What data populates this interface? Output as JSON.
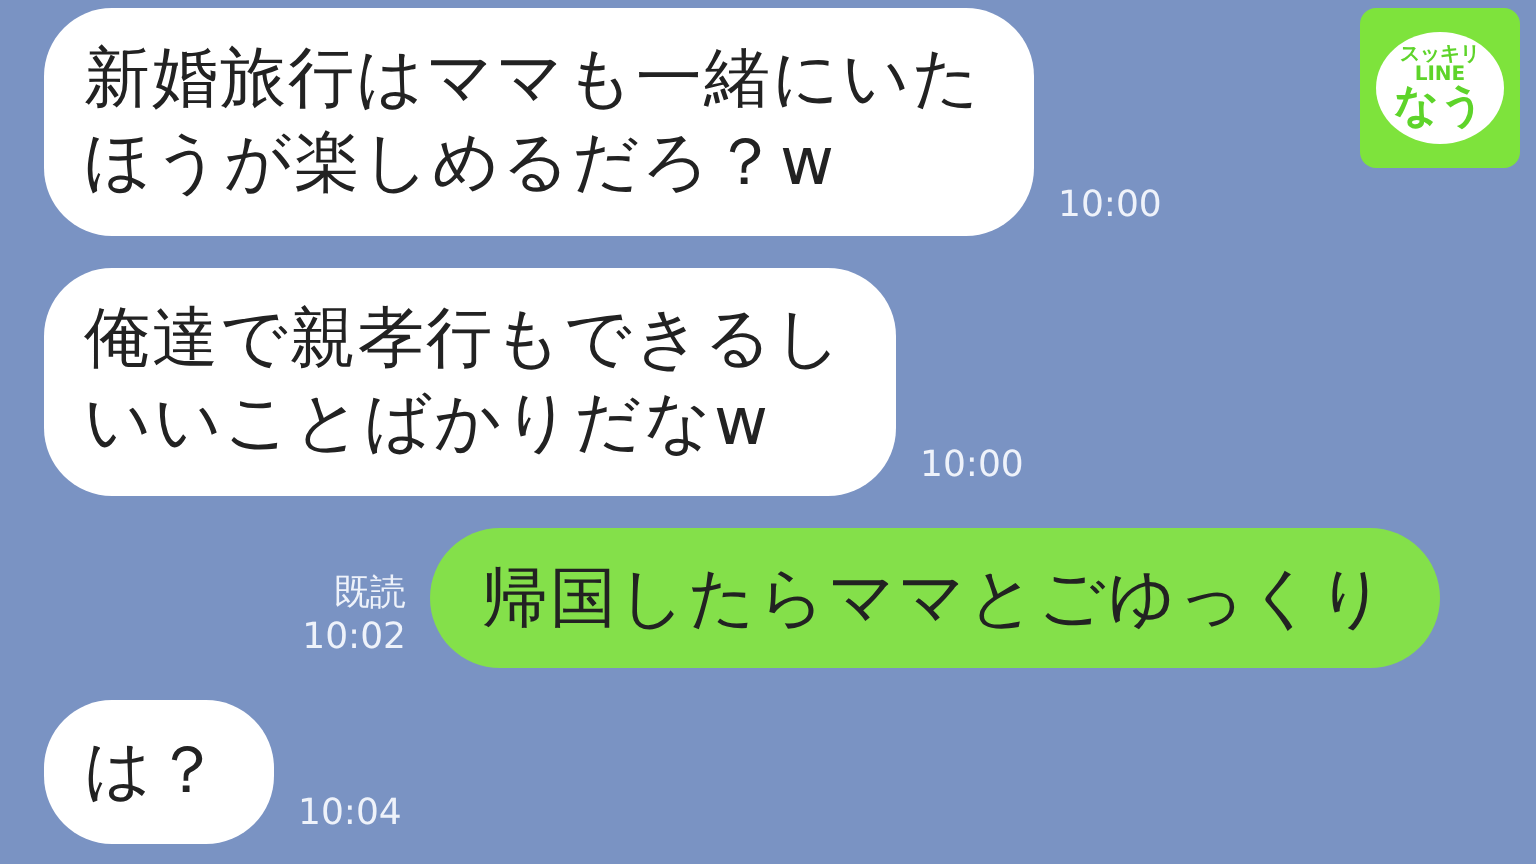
{
  "logo": {
    "lines": [
      "スッキリ",
      "LINE",
      "なう"
    ]
  },
  "messages": [
    {
      "kind": "incoming",
      "lines": [
        "新婚旅行はママも一緒にいた",
        "ほうが楽しめるだろ？w"
      ],
      "time": "10:00"
    },
    {
      "kind": "incoming",
      "lines": [
        "俺達で親孝行もできるし",
        "いいことばかりだなw"
      ],
      "time": "10:00"
    },
    {
      "kind": "outgoing",
      "lines": [
        "帰国したらママとごゆっくり"
      ],
      "read": "既読",
      "time": "10:02"
    },
    {
      "kind": "incoming",
      "lines": [
        "は？"
      ],
      "time": "10:04"
    }
  ]
}
